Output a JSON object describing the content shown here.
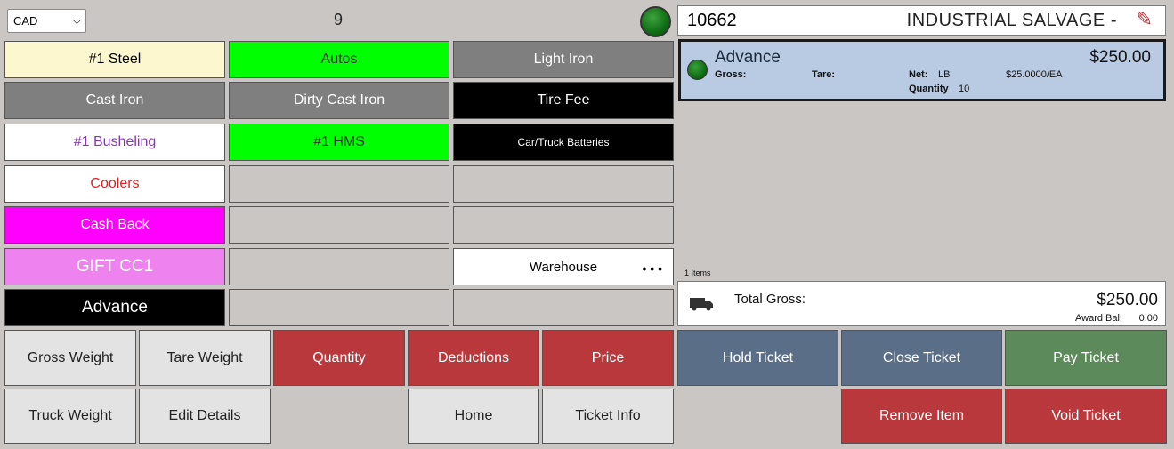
{
  "header": {
    "currency": "CAD",
    "item_count": "9",
    "status_color": "#117a17"
  },
  "products": [
    {
      "label": "#1 Steel",
      "bg": "#fcf7cf",
      "fg": "#000000"
    },
    {
      "label": "Autos",
      "bg": "#00ff00",
      "fg": "#333333"
    },
    {
      "label": "Light Iron",
      "bg": "#7f7f7f",
      "fg": "#ffffff"
    },
    {
      "label": "Cast Iron",
      "bg": "#7f7f7f",
      "fg": "#ffffff"
    },
    {
      "label": "Dirty Cast Iron",
      "bg": "#7f7f7f",
      "fg": "#ffffff"
    },
    {
      "label": "Tire Fee",
      "bg": "#000000",
      "fg": "#ffffff"
    },
    {
      "label": "#1 Busheling",
      "bg": "#ffffff",
      "fg": "#8a35b6"
    },
    {
      "label": "#1 HMS",
      "bg": "#00ff00",
      "fg": "#333333"
    },
    {
      "label": "Car/Truck Batteries",
      "bg": "#000000",
      "fg": "#ffffff"
    },
    {
      "label": "Coolers",
      "bg": "#ffffff",
      "fg": "#e02020"
    },
    {
      "label": "",
      "bg": "#c9c6c4",
      "fg": "#000000"
    },
    {
      "label": "",
      "bg": "#c9c6c4",
      "fg": "#000000"
    },
    {
      "label": "Cash Back",
      "bg": "#ff00ff",
      "fg": "#ffffff"
    },
    {
      "label": "",
      "bg": "#c9c6c4",
      "fg": "#000000"
    },
    {
      "label": "",
      "bg": "#c9c6c4",
      "fg": "#000000"
    },
    {
      "label": "GIFT CC1",
      "bg": "#ee82ee",
      "fg": "#ffffff"
    },
    {
      "label": "",
      "bg": "#c9c6c4",
      "fg": "#000000"
    },
    {
      "label": "Warehouse",
      "bg": "#ffffff",
      "fg": "#000000",
      "more": "• • •"
    },
    {
      "label": "Advance",
      "bg": "#000000",
      "fg": "#ffffff"
    },
    {
      "label": "",
      "bg": "#c9c6c4",
      "fg": "#000000"
    },
    {
      "label": "",
      "bg": "#c9c6c4",
      "fg": "#000000"
    }
  ],
  "customer": {
    "id": "10662",
    "name": "INDUSTRIAL SALVAGE  -",
    "edit_icon": "pencil-icon"
  },
  "ticket_line": {
    "name": "Advance",
    "amount": "$250.00",
    "gross_label": "Gross:",
    "tare_label": "Tare:",
    "net_label": "Net:",
    "net_unit": "LB",
    "unit_price": "$25.0000/EA",
    "quantity_label": "Quantity",
    "quantity": "10"
  },
  "items_count_label": "1  Items",
  "totals": {
    "icon": "truck-icon",
    "label": "Total Gross:",
    "value": "$250.00",
    "award_label": "Award Bal:",
    "award_value": "0.00"
  },
  "buttons": {
    "gross_weight": "Gross Weight",
    "tare_weight": "Tare Weight",
    "quantity": "Quantity",
    "deductions": "Deductions",
    "price": "Price",
    "hold_ticket": "Hold Ticket",
    "close_ticket": "Close Ticket",
    "pay_ticket": "Pay Ticket",
    "truck_weight": "Truck Weight",
    "edit_details": "Edit Details",
    "home": "Home",
    "ticket_info": "Ticket Info",
    "remove_item": "Remove Item",
    "void_ticket": "Void Ticket"
  }
}
